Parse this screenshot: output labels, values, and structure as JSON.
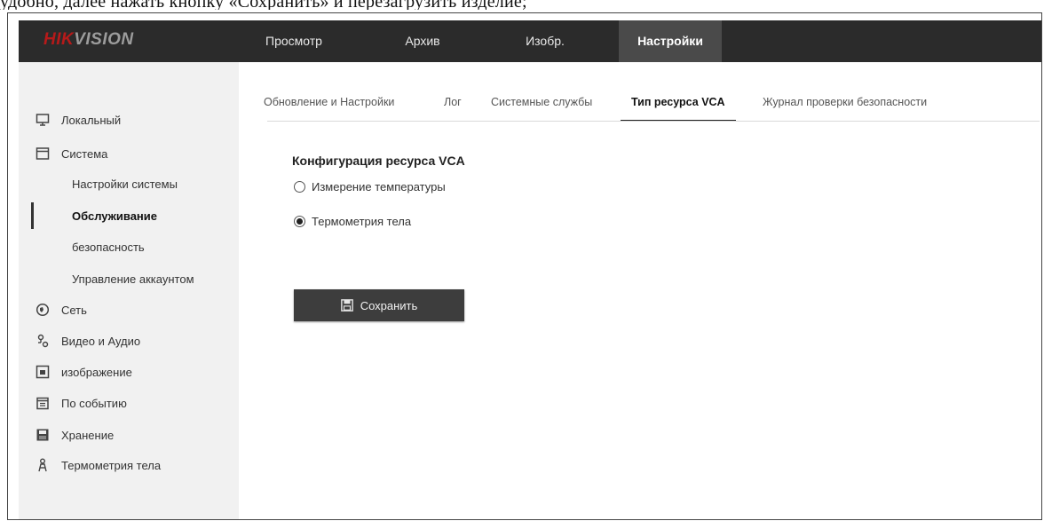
{
  "page_header_text": "удобно, далее нажать кнопку «Сохранить» и перезагрузить изделие;",
  "brand": {
    "logo_hik": "HIK",
    "logo_vision": "VISION"
  },
  "topnav": [
    {
      "label": "Просмотр"
    },
    {
      "label": "Архив"
    },
    {
      "label": "Изобр."
    },
    {
      "label": "Настройки",
      "active": true
    }
  ],
  "sidebar": {
    "items": [
      {
        "label": "Локальный",
        "icon": "monitor-icon"
      },
      {
        "label": "Система",
        "icon": "window-icon"
      },
      {
        "label": "Настройки системы",
        "sub": true
      },
      {
        "label": "Обслуживание",
        "sub": true,
        "active": true
      },
      {
        "label": "безопасность",
        "sub": true
      },
      {
        "label": "Управление аккаунтом",
        "sub": true
      },
      {
        "label": "Сеть",
        "icon": "network-icon"
      },
      {
        "label": "Видео и Аудио",
        "icon": "video-audio-icon"
      },
      {
        "label": "изображение",
        "icon": "image-icon"
      },
      {
        "label": "По событию",
        "icon": "calendar-icon"
      },
      {
        "label": "Хранение",
        "icon": "storage-icon"
      },
      {
        "label": "Термометрия тела",
        "icon": "person-icon"
      }
    ]
  },
  "tabs": [
    {
      "label": "Обновление и Настройки"
    },
    {
      "label": "Лог"
    },
    {
      "label": "Системные службы"
    },
    {
      "label": "Тип ресурса VCA",
      "active": true
    },
    {
      "label": "Журнал проверки безопасности"
    }
  ],
  "content": {
    "section_title": "Конфигурация ресурса VCA",
    "options": [
      {
        "label": "Измерение температуры",
        "checked": false
      },
      {
        "label": "Термометрия тела",
        "checked": true
      }
    ],
    "save_label": "Сохранить"
  },
  "colors": {
    "topbar": "#2b2b2b",
    "active_tab_bg": "#4a4a4a",
    "sidebar_bg": "#f1f1f1",
    "button": "#3d3d3d",
    "logo_red": "#b61a1a"
  }
}
